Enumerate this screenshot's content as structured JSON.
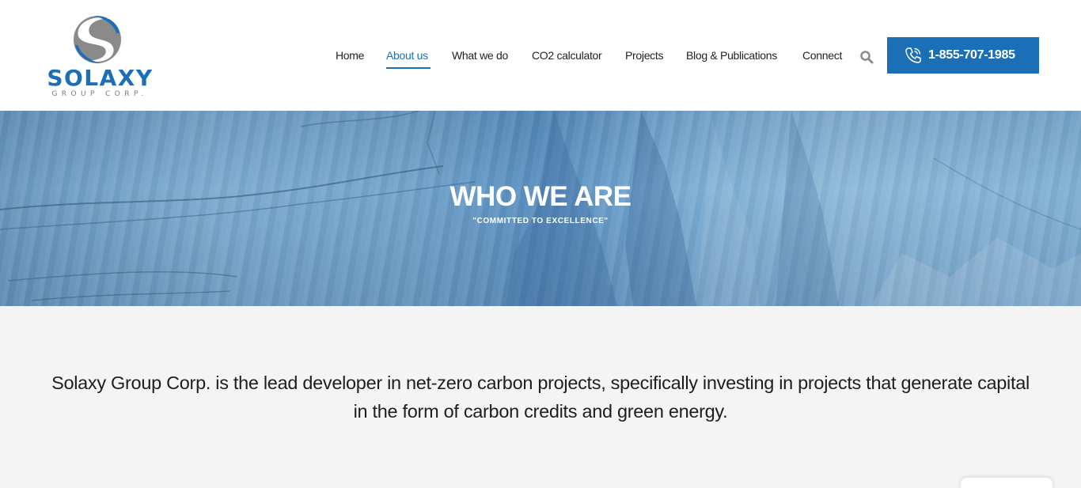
{
  "brand": {
    "name": "SOLAXY",
    "subtitle": "GROUP CORP.",
    "primary_color": "#1b6fb6",
    "secondary_color": "#7a7a7a"
  },
  "nav": {
    "items": [
      {
        "label": "Home",
        "active": false
      },
      {
        "label": "About us",
        "active": true
      },
      {
        "label": "What we do",
        "active": false
      },
      {
        "label": "CO2 calculator",
        "active": false
      },
      {
        "label": "Projects",
        "active": false
      },
      {
        "label": "Blog & Publications",
        "active": false
      },
      {
        "label": "Connect",
        "active": false
      }
    ],
    "search_icon": "search-icon"
  },
  "contact": {
    "phone_label": "1-855-707-1985",
    "icon": "phone-icon"
  },
  "hero": {
    "title": "WHO WE ARE",
    "subtitle": "\"COMMITTED TO EXCELLENCE\""
  },
  "intro": {
    "text": "Solaxy Group Corp. is the lead developer in net-zero carbon projects, specifically investing in projects that generate capital in the form of carbon credits and green energy."
  }
}
